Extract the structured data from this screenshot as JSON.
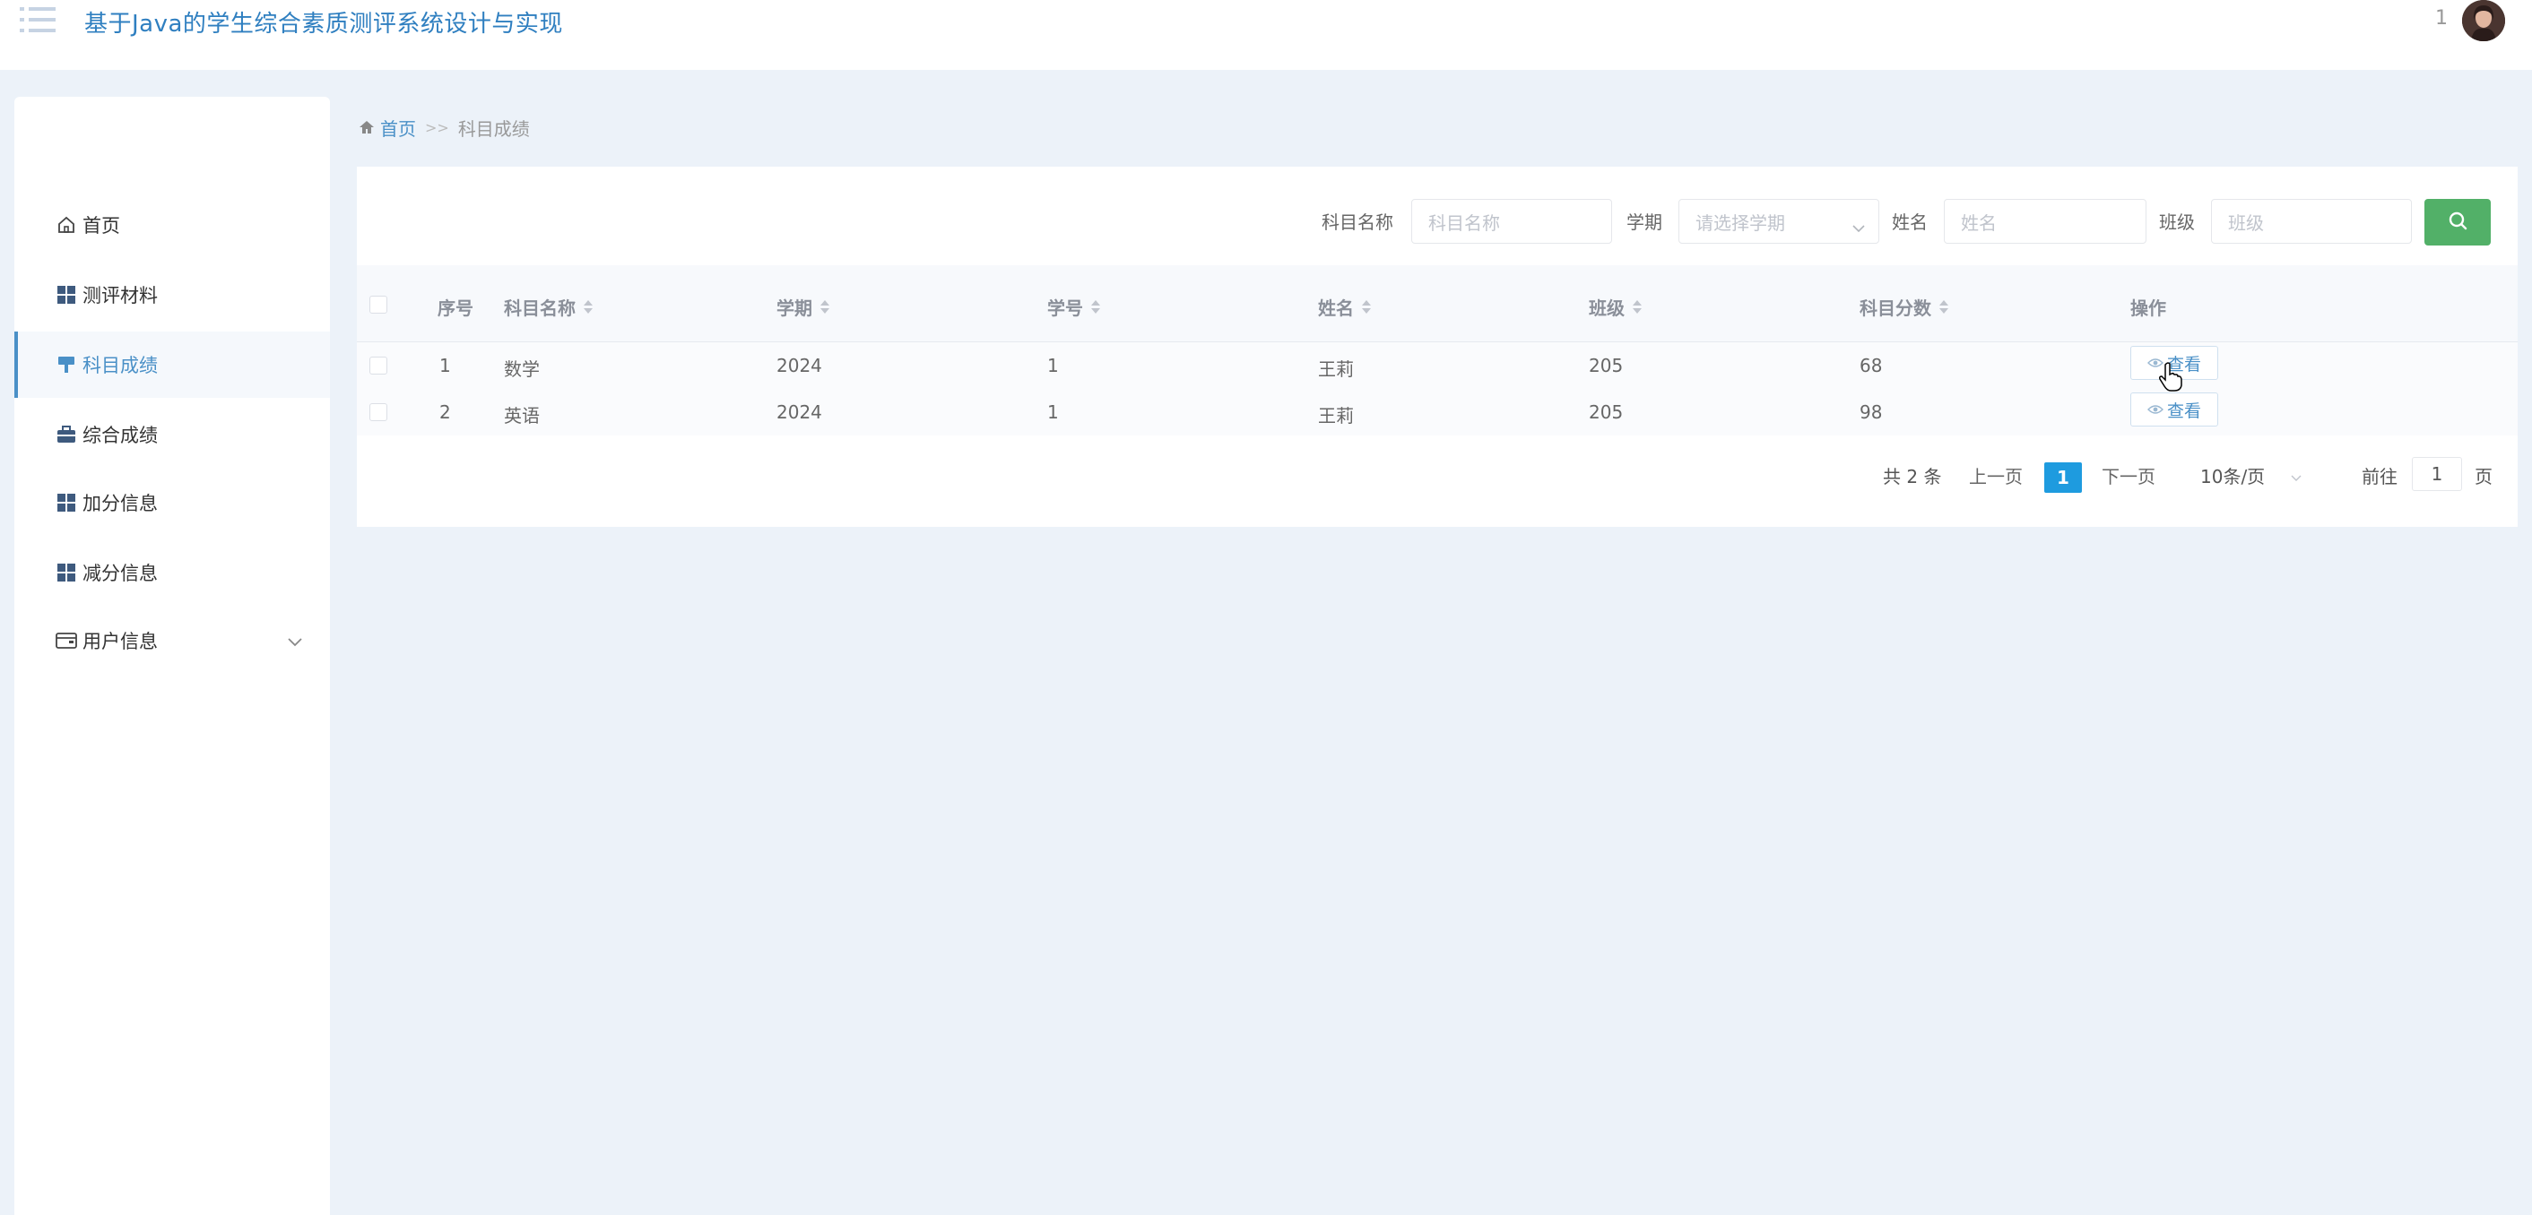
{
  "header": {
    "title": "基于Java的学生综合素质测评系统设计与实现",
    "user_count": "1",
    "menu_icon": "menu-list-icon",
    "avatar": "user-avatar"
  },
  "sidebar": {
    "items": [
      {
        "label": "首页",
        "icon": "home-icon"
      },
      {
        "label": "测评材料",
        "icon": "grid-icon"
      },
      {
        "label": "科目成绩",
        "icon": "brush-icon",
        "active": true
      },
      {
        "label": "综合成绩",
        "icon": "briefcase-icon"
      },
      {
        "label": "加分信息",
        "icon": "grid-icon"
      },
      {
        "label": "减分信息",
        "icon": "grid-icon"
      },
      {
        "label": "用户信息",
        "icon": "wallet-icon",
        "expandable": true
      }
    ]
  },
  "breadcrumb": {
    "home": "首页",
    "separator": ">>",
    "current": "科目成绩"
  },
  "search": {
    "subject_label": "科目名称",
    "subject_placeholder": "科目名称",
    "term_label": "学期",
    "term_placeholder": "请选择学期",
    "name_label": "姓名",
    "name_placeholder": "姓名",
    "class_label": "班级",
    "class_placeholder": "班级"
  },
  "table": {
    "headers": [
      "序号",
      "科目名称",
      "学期",
      "学号",
      "姓名",
      "班级",
      "科目分数",
      "操作"
    ],
    "rows": [
      {
        "index": "1",
        "subject": "数学",
        "term": "2024",
        "student_id": "1",
        "name": "王莉",
        "class": "205",
        "score": "68",
        "action": "查看"
      },
      {
        "index": "2",
        "subject": "英语",
        "term": "2024",
        "student_id": "1",
        "name": "王莉",
        "class": "205",
        "score": "98",
        "action": "查看"
      }
    ]
  },
  "pagination": {
    "total": "共 2 条",
    "prev": "上一页",
    "current_page": "1",
    "next": "下一页",
    "page_size": "10条/页",
    "goto_label": "前往",
    "goto_value": "1",
    "page_unit": "页"
  },
  "colors": {
    "accent": "#4a90c7",
    "search_button": "#52b068",
    "current_page": "#1e9bdf",
    "background": "#ecf2f9"
  }
}
